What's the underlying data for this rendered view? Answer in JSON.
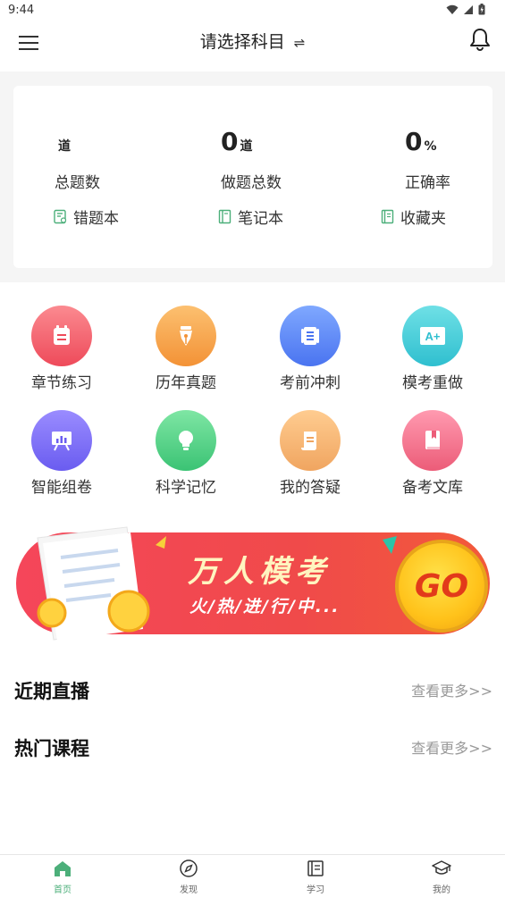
{
  "status_bar": {
    "time": "9:44"
  },
  "header": {
    "title": "请选择科目",
    "swap_symbol": "⇌"
  },
  "stats": {
    "total": {
      "value": "",
      "unit": "道",
      "label": "总题数"
    },
    "done": {
      "value": "0",
      "unit": "道",
      "label": "做题总数"
    },
    "accuracy": {
      "value": "0",
      "unit": "%",
      "label": "正确率"
    }
  },
  "links": {
    "wrong": "错题本",
    "notes": "笔记本",
    "favorites": "收藏夹"
  },
  "grid": [
    {
      "label": "章节练习",
      "icon": "chapter-practice-icon",
      "color_from": "#fb8a90",
      "color_to": "#ee4a5a"
    },
    {
      "label": "历年真题",
      "icon": "pen-nib-icon",
      "color_from": "#fcc070",
      "color_to": "#f39236"
    },
    {
      "label": "考前冲刺",
      "icon": "scroll-icon",
      "color_from": "#7fa8ff",
      "color_to": "#4a74f0"
    },
    {
      "label": "模考重做",
      "icon": "a-plus-icon",
      "color_from": "#6fe0e6",
      "color_to": "#2fbfcf"
    },
    {
      "label": "智能组卷",
      "icon": "presentation-board-icon",
      "color_from": "#9a8cff",
      "color_to": "#6a5cf0"
    },
    {
      "label": "科学记忆",
      "icon": "lightbulb-icon",
      "color_from": "#7fe6a4",
      "color_to": "#3bc374"
    },
    {
      "label": "我的答疑",
      "icon": "scroll-note-icon",
      "color_from": "#ffcc90",
      "color_to": "#f0a560"
    },
    {
      "label": "备考文库",
      "icon": "book-icon",
      "color_from": "#ff9ab0",
      "color_to": "#ec5c78"
    }
  ],
  "banner": {
    "title": "万人模考",
    "subtitle": "火/热/进/行/中...",
    "go": "GO"
  },
  "sections": {
    "live": {
      "title": "近期直播",
      "more": "查看更多>>"
    },
    "courses": {
      "title": "热门课程",
      "more": "查看更多>>"
    }
  },
  "tabs": [
    {
      "label": "首页",
      "icon": "home-icon",
      "active": true
    },
    {
      "label": "发现",
      "icon": "compass-icon",
      "active": false
    },
    {
      "label": "学习",
      "icon": "notebook-icon",
      "active": false
    },
    {
      "label": "我的",
      "icon": "graduation-cap-icon",
      "active": false
    }
  ],
  "colors": {
    "accent": "#4caf7a",
    "banner_red": "#f04a4a",
    "go_yellow": "#ffc21a"
  }
}
